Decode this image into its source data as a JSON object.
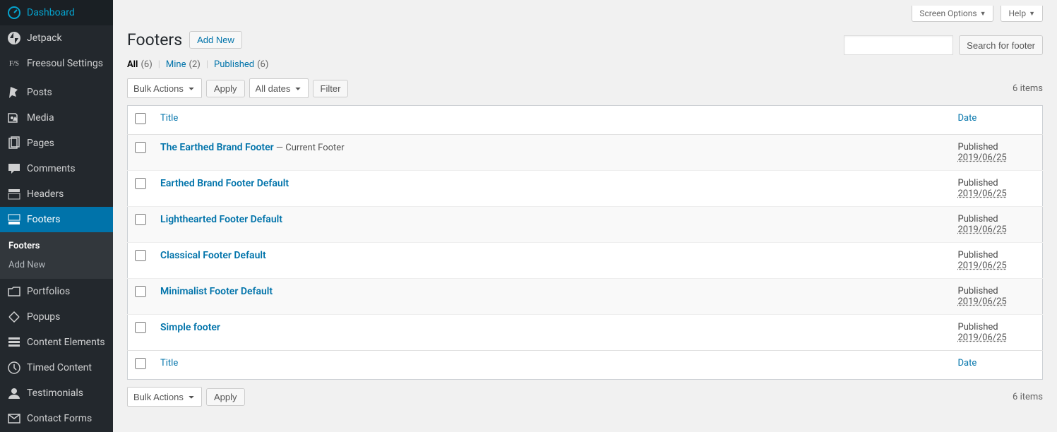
{
  "sidebar": {
    "items": [
      {
        "label": "Dashboard",
        "icon": "dashboard"
      },
      {
        "label": "Jetpack",
        "icon": "jetpack"
      },
      {
        "label": "Freesoul Settings",
        "icon": "fs"
      }
    ],
    "items2": [
      {
        "label": "Posts",
        "icon": "pin"
      },
      {
        "label": "Media",
        "icon": "media"
      },
      {
        "label": "Pages",
        "icon": "pages"
      },
      {
        "label": "Comments",
        "icon": "comments"
      },
      {
        "label": "Headers",
        "icon": "headers"
      },
      {
        "label": "Footers",
        "icon": "footers",
        "active": true
      }
    ],
    "submenu": [
      {
        "label": "Footers",
        "current": true
      },
      {
        "label": "Add New"
      }
    ],
    "items3": [
      {
        "label": "Portfolios",
        "icon": "portfolio"
      },
      {
        "label": "Popups",
        "icon": "popups"
      },
      {
        "label": "Content Elements",
        "icon": "content"
      },
      {
        "label": "Timed Content",
        "icon": "timed"
      },
      {
        "label": "Testimonials",
        "icon": "testimonials"
      },
      {
        "label": "Contact Forms",
        "icon": "mail"
      }
    ]
  },
  "top": {
    "screen_options": "Screen Options",
    "help": "Help"
  },
  "heading": {
    "title": "Footers",
    "add_new": "Add New"
  },
  "filters": {
    "all": "All",
    "all_count": "(6)",
    "mine": "Mine",
    "mine_count": "(2)",
    "published": "Published",
    "published_count": "(6)"
  },
  "actions": {
    "bulk": "Bulk Actions",
    "apply": "Apply",
    "all_dates": "All dates",
    "filter": "Filter",
    "items_count": "6 items",
    "search_btn": "Search for footer"
  },
  "table": {
    "col_title": "Title",
    "col_date": "Date",
    "rows": [
      {
        "title": "The Earthed Brand Footer",
        "suffix": " — Current Footer",
        "status": "Published",
        "date": "2019/06/25"
      },
      {
        "title": "Earthed Brand Footer Default",
        "suffix": "",
        "status": "Published",
        "date": "2019/06/25"
      },
      {
        "title": "Lighthearted Footer Default",
        "suffix": "",
        "status": "Published",
        "date": "2019/06/25"
      },
      {
        "title": "Classical Footer Default",
        "suffix": "",
        "status": "Published",
        "date": "2019/06/25"
      },
      {
        "title": "Minimalist Footer Default",
        "suffix": "",
        "status": "Published",
        "date": "2019/06/25"
      },
      {
        "title": "Simple footer",
        "suffix": "",
        "status": "Published",
        "date": "2019/06/25"
      }
    ]
  }
}
